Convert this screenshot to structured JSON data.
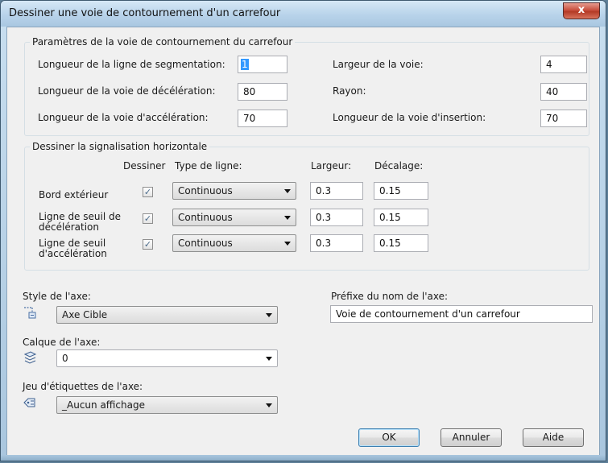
{
  "window": {
    "title": "Dessiner une voie de contournement d'un carrefour",
    "close_label": "x"
  },
  "params": {
    "title": "Paramètres de la voie de contournement du carrefour",
    "seg_length_label": "Longueur de la ligne de segmentation:",
    "seg_length_value": "1",
    "decel_length_label": "Longueur de la voie de décélération:",
    "decel_length_value": "80",
    "accel_length_label": "Longueur de la voie d'accélération:",
    "accel_length_value": "70",
    "lane_width_label": "Largeur de la voie:",
    "lane_width_value": "4",
    "radius_label": "Rayon:",
    "radius_value": "40",
    "insert_length_label": "Longueur de la voie d'insertion:",
    "insert_length_value": "70"
  },
  "markings": {
    "title": "Dessiner la signalisation horizontale",
    "headers": {
      "draw": "Dessiner",
      "line_type": "Type de ligne:",
      "width": "Largeur:",
      "offset": "Décalage:"
    },
    "rows": [
      {
        "label": "Bord extérieur",
        "checked": true,
        "line_type": "Continuous",
        "width": "0.3",
        "offset": "0.15"
      },
      {
        "label": "Ligne de seuil de décélération",
        "checked": true,
        "line_type": "Continuous",
        "width": "0.3",
        "offset": "0.15"
      },
      {
        "label": "Ligne de seuil d'accélération",
        "checked": true,
        "line_type": "Continuous",
        "width": "0.3",
        "offset": "0.15"
      }
    ]
  },
  "axis": {
    "style_label": "Style de l'axe:",
    "style_value": "Axe Cible",
    "layer_label": "Calque de l'axe:",
    "layer_value": "0",
    "labelset_label": "Jeu d'étiquettes de l'axe:",
    "labelset_value": "_Aucun affichage",
    "prefix_label": "Préfixe du nom de l'axe:",
    "prefix_value": "Voie de contournement d'un carrefour"
  },
  "buttons": {
    "ok": "OK",
    "cancel": "Annuler",
    "help": "Aide"
  },
  "icons": {
    "check": "checkmark-icon",
    "axis_style": "axis-style-icon",
    "layer": "layer-stack-icon",
    "labelset": "label-set-icon"
  }
}
